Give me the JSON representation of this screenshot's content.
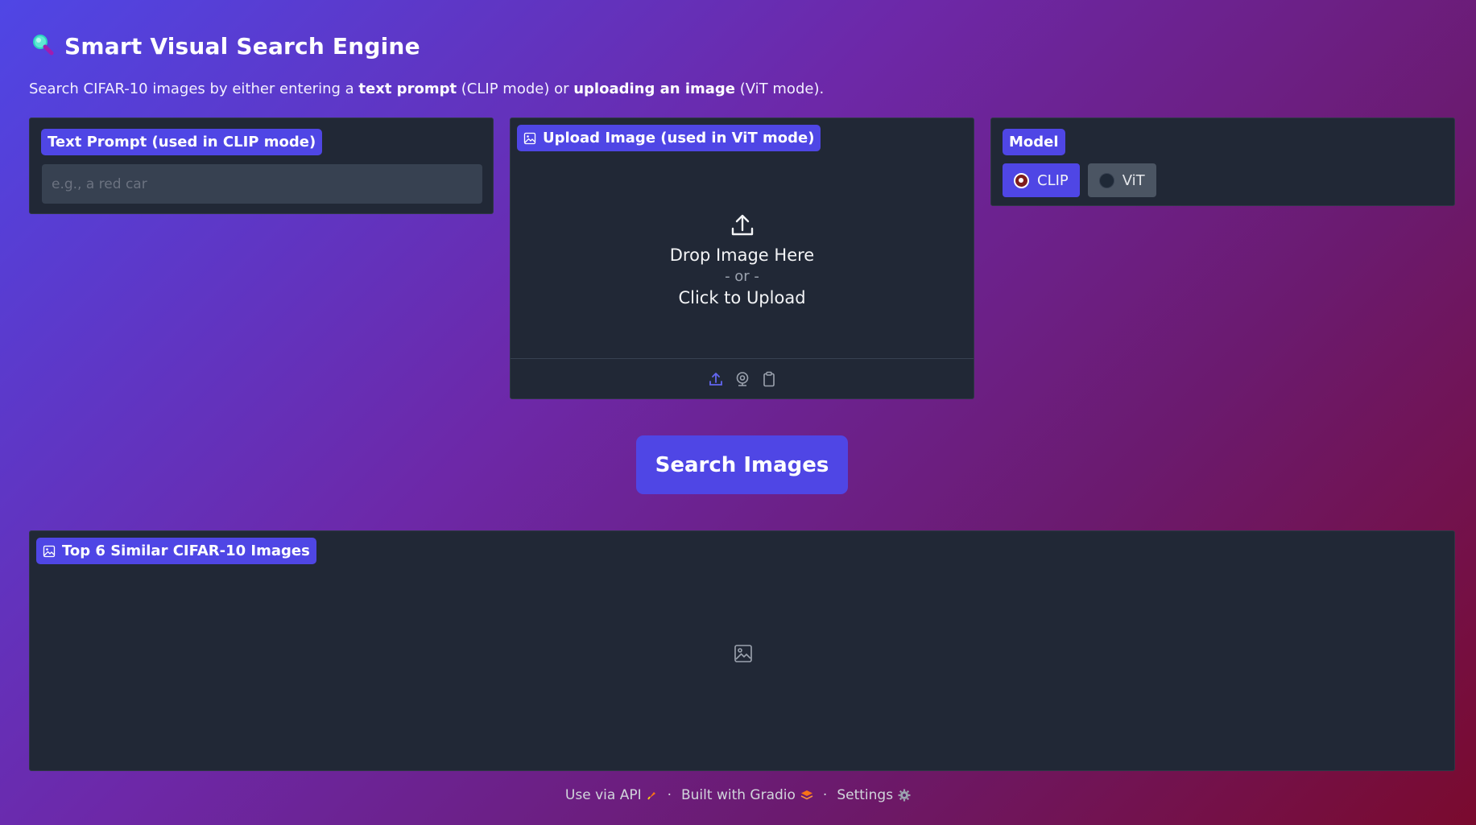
{
  "header": {
    "title": "Smart Visual Search Engine",
    "description_parts": [
      "Search CIFAR-10 images by either entering a ",
      "text prompt",
      " (CLIP mode) or ",
      "uploading an image",
      " (ViT mode)."
    ]
  },
  "text_prompt": {
    "label": "Text Prompt (used in CLIP mode)",
    "value": "",
    "placeholder": "e.g., a red car"
  },
  "upload": {
    "label": "Upload Image (used in ViT mode)",
    "drop_text": "Drop Image Here",
    "or_text": "- or -",
    "click_text": "Click to Upload",
    "toolbar_icons": [
      "upload-icon",
      "webcam-icon",
      "clipboard-icon"
    ]
  },
  "model": {
    "label": "Model",
    "options": [
      {
        "label": "CLIP",
        "selected": true
      },
      {
        "label": "ViT",
        "selected": false
      }
    ]
  },
  "search_button": "Search Images",
  "gallery": {
    "label": "Top 6 Similar CIFAR-10 Images"
  },
  "footer": {
    "api": "Use via API",
    "built": "Built with Gradio",
    "settings": "Settings",
    "separator": "·"
  },
  "colors": {
    "accent": "#4f46e5",
    "panel": "#212836",
    "input": "#374151"
  }
}
